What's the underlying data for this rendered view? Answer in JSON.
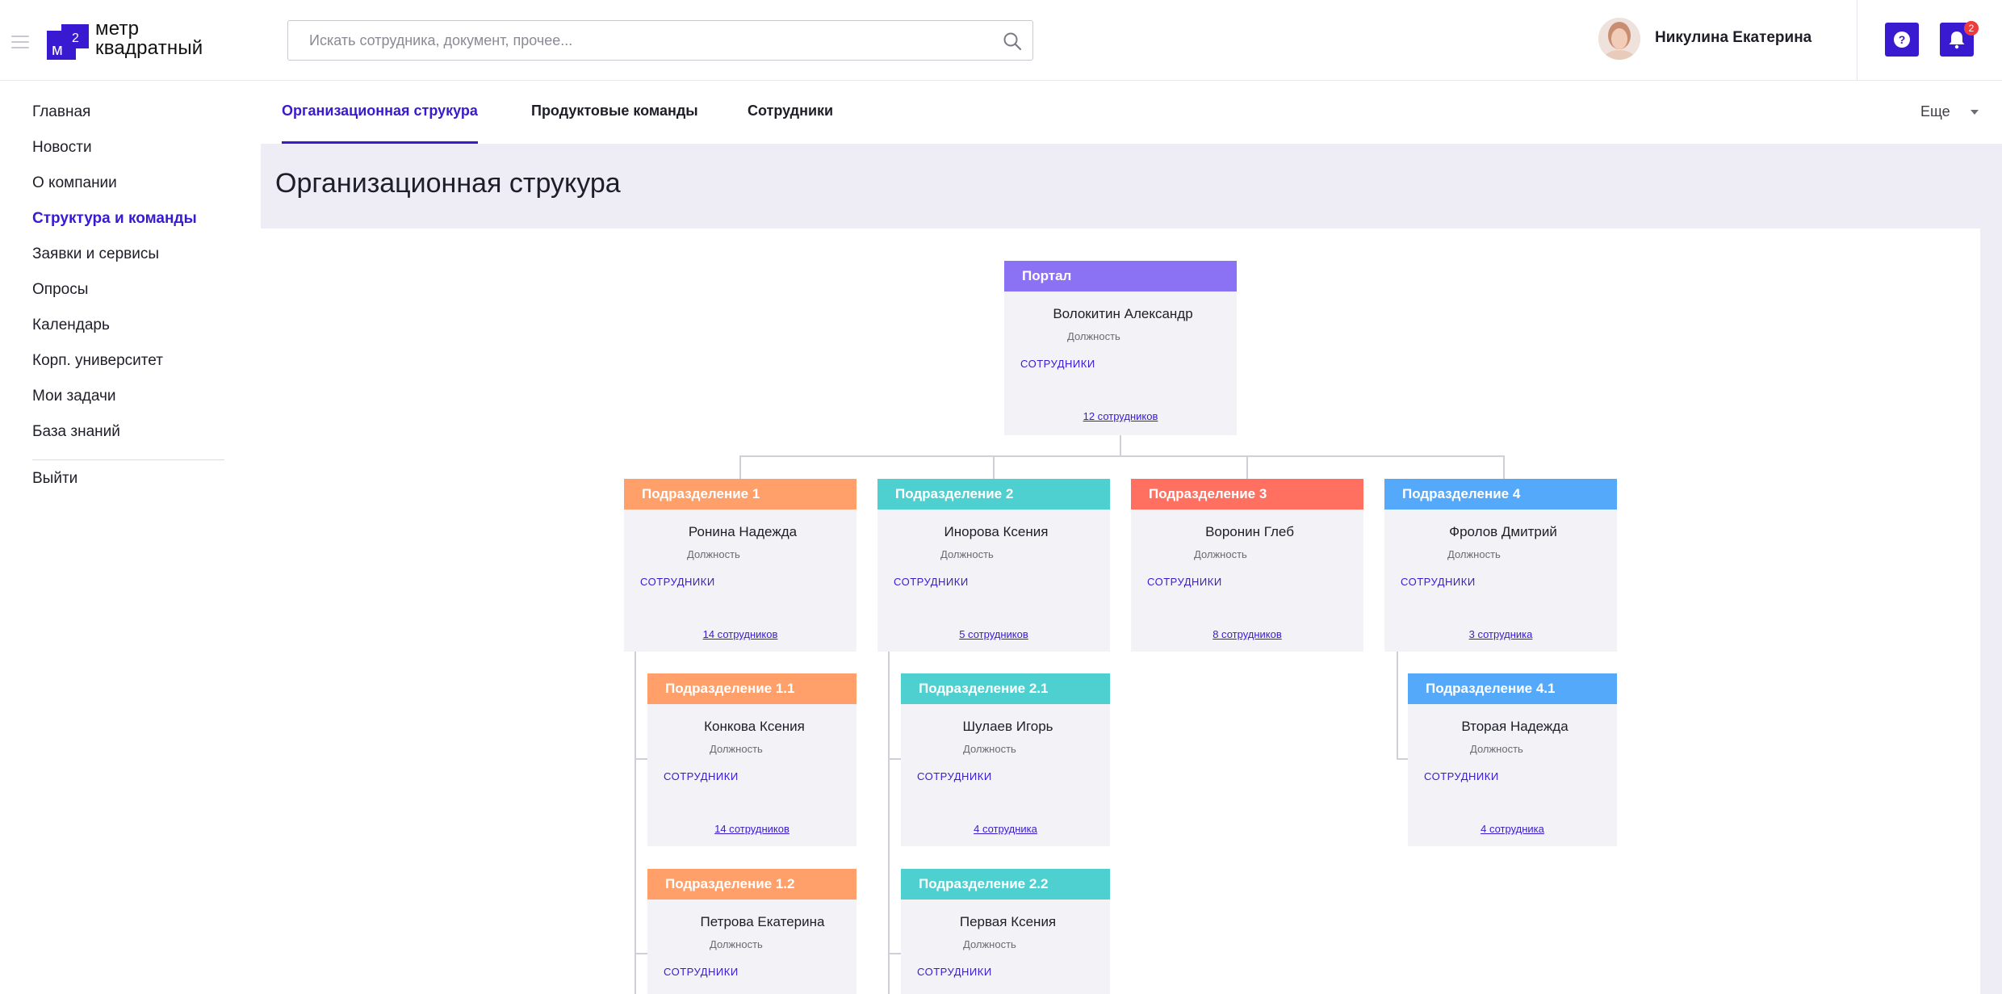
{
  "brand": {
    "line1": "метр",
    "line2": "квадратный",
    "mark_text": "м",
    "mark_sup": "2"
  },
  "search": {
    "placeholder": "Искать сотрудника, документ, прочее..."
  },
  "user": {
    "name": "Никулина Екатерина"
  },
  "notifications": {
    "count": "2"
  },
  "sidebar": {
    "items": [
      {
        "label": "Главная"
      },
      {
        "label": "Новости"
      },
      {
        "label": "О компании"
      },
      {
        "label": "Структура и команды"
      },
      {
        "label": "Заявки и сервисы"
      },
      {
        "label": "Опросы"
      },
      {
        "label": "Календарь"
      },
      {
        "label": "Корп. университет"
      },
      {
        "label": "Мои задачи"
      },
      {
        "label": "База знаний"
      }
    ],
    "logout": "Выйти"
  },
  "tabs": [
    {
      "label": "Организационная струкура"
    },
    {
      "label": "Продуктовые команды"
    },
    {
      "label": "Сотрудники"
    }
  ],
  "more": "Еще",
  "page_title": "Организационная струкура",
  "colors": {
    "accent": "#3a1ad1",
    "portal": "#8b72f4",
    "dept1": "#ffa06a",
    "dept2": "#4ecfd0",
    "dept3": "#ff7060",
    "dept4": "#55a9fa"
  },
  "org": {
    "portal": {
      "title": "Портал",
      "name": "Волокитин Александр",
      "role": "Должность",
      "link": "СОТРУДНИКИ",
      "count": "12 сотрудников"
    },
    "departments": [
      {
        "title": "Подразделение 1",
        "name": "Ронина Надежда",
        "role": "Должность",
        "link": "СОТРУДНИКИ",
        "count": "14 сотрудников",
        "children": [
          {
            "title": "Подразделение 1.1",
            "name": "Конкова Ксения",
            "role": "Должность",
            "link": "СОТРУДНИКИ",
            "count": "14 сотрудников"
          },
          {
            "title": "Подразделение 1.2",
            "name": "Петрова Екатерина",
            "role": "Должность",
            "link": "СОТРУДНИКИ"
          }
        ]
      },
      {
        "title": "Подразделение 2",
        "name": "Инорова Ксения",
        "role": "Должность",
        "link": "СОТРУДНИКИ",
        "count": "5 сотрудников",
        "children": [
          {
            "title": "Подразделение 2.1",
            "name": "Шулаев Игорь",
            "role": "Должность",
            "link": "СОТРУДНИКИ",
            "count": "4 сотрудника"
          },
          {
            "title": "Подразделение 2.2",
            "name": "Первая Ксения",
            "role": "Должность",
            "link": "СОТРУДНИКИ"
          }
        ]
      },
      {
        "title": "Подразделение 3",
        "name": "Воронин Глеб",
        "role": "Должность",
        "link": "СОТРУДНИКИ",
        "count": "8 сотрудников",
        "children": []
      },
      {
        "title": "Подразделение 4",
        "name": "Фролов Дмитрий",
        "role": "Должность",
        "link": "СОТРУДНИКИ",
        "count": "3 сотрудника",
        "children": [
          {
            "title": "Подразделение 4.1",
            "name": "Вторая Надежда",
            "role": "Должность",
            "link": "СОТРУДНИКИ",
            "count": "4 сотрудника"
          }
        ]
      }
    ]
  }
}
